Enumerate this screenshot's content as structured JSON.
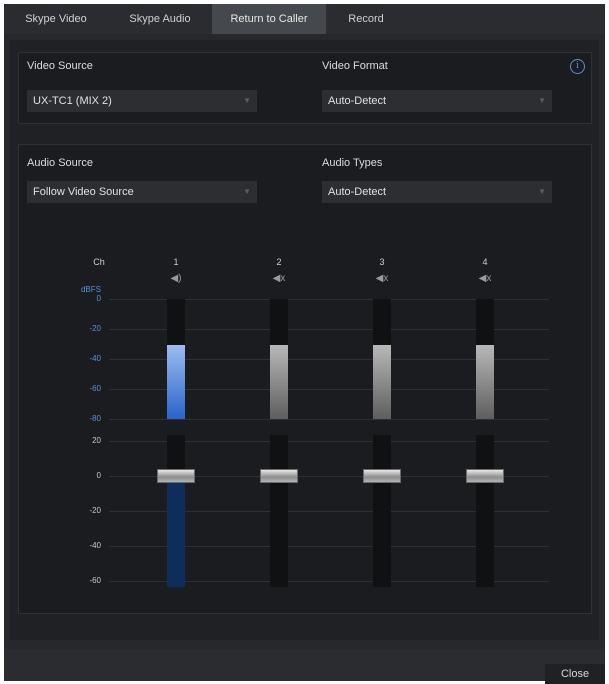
{
  "tabs": [
    {
      "label": "Skype Video"
    },
    {
      "label": "Skype Audio"
    },
    {
      "label": "Return to Caller",
      "active": true
    },
    {
      "label": "Record"
    }
  ],
  "video": {
    "source_label": "Video Source",
    "source_value": "UX-TC1 (MIX 2)",
    "format_label": "Video Format",
    "format_value": "Auto-Detect",
    "info_icon": "i"
  },
  "audio": {
    "source_label": "Audio Source",
    "source_value": "Follow Video Source",
    "types_label": "Audio Types",
    "types_value": "Auto-Detect"
  },
  "mixer": {
    "ch_label": "Ch",
    "unit_label": "dBFS",
    "channels": [
      {
        "number": "1",
        "icon": "speaker-on-icon",
        "icon_glyph": "◀)",
        "muted": false,
        "meter_level": 0.62,
        "fader_level": 0.73
      },
      {
        "number": "2",
        "icon": "speaker-muted-icon",
        "icon_glyph": "◀x",
        "muted": true,
        "meter_level": 0.62,
        "fader_level": 0.73
      },
      {
        "number": "3",
        "icon": "speaker-muted-icon",
        "icon_glyph": "◀x",
        "muted": true,
        "meter_level": 0.62,
        "fader_level": 0.73
      },
      {
        "number": "4",
        "icon": "speaker-muted-icon",
        "icon_glyph": "◀x",
        "muted": true,
        "meter_level": 0.62,
        "fader_level": 0.73
      }
    ],
    "meter_scale": [
      "0",
      "-20",
      "-40",
      "-60",
      "-80"
    ],
    "fader_scale": [
      "20",
      "0",
      "-20",
      "-40",
      "-60"
    ],
    "colors": {
      "active_meter": "#2a63c9",
      "inactive_meter": "#9a9a9a",
      "active_fader_fill": "#0f2c5a"
    }
  },
  "footer": {
    "close_label": "Close"
  }
}
